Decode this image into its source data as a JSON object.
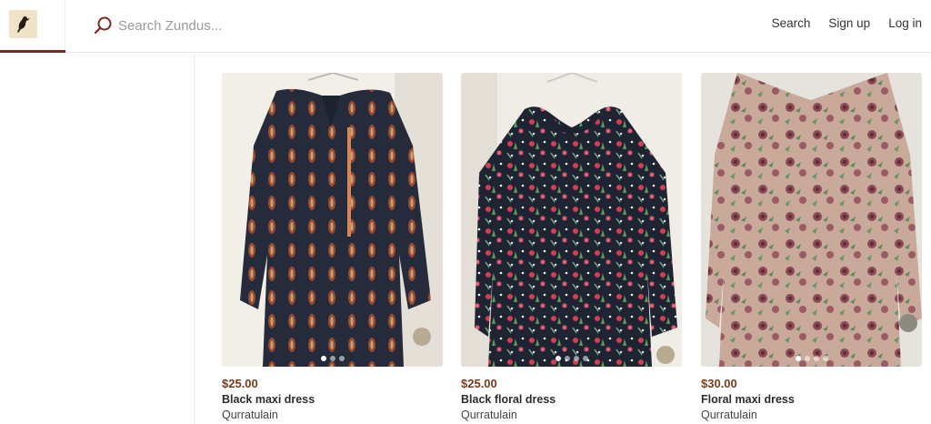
{
  "header": {
    "logo_icon": "bird-logo-icon",
    "search_placeholder": "Search Zundus...",
    "nav": {
      "search": "Search",
      "signup": "Sign up",
      "login": "Log in"
    }
  },
  "colors": {
    "brand": "#7a2a22",
    "price": "#7a3b1a",
    "logo_bg": "#efe3c8"
  },
  "listings": [
    {
      "price": "$25.00",
      "title": "Black maxi dress",
      "seller": "Qurratulain",
      "image_dots": 3,
      "active_dot": 1
    },
    {
      "price": "$25.00",
      "title": "Black floral dress",
      "seller": "Qurratulain",
      "image_dots": 4,
      "active_dot": 1
    },
    {
      "price": "$30.00",
      "title": "Floral maxi dress",
      "seller": "Qurratulain",
      "image_dots": 4,
      "active_dot": 1
    }
  ]
}
